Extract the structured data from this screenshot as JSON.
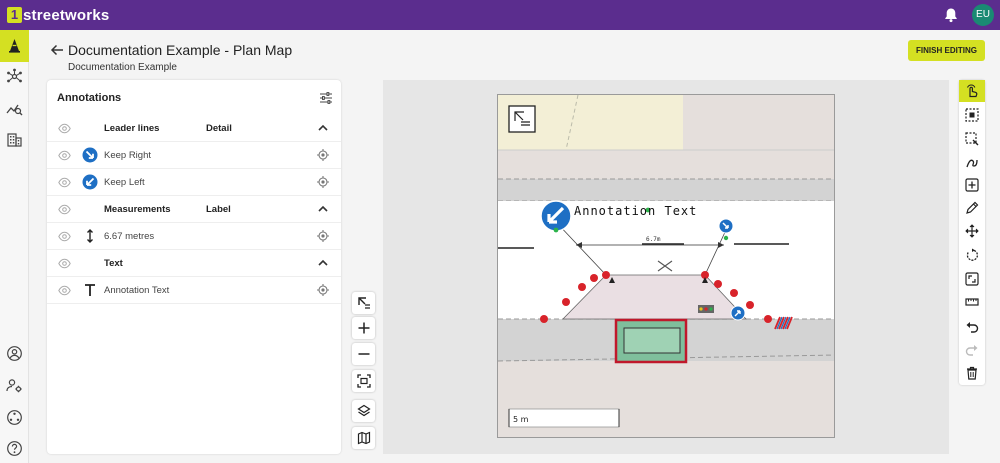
{
  "app": {
    "logo_mark": "1",
    "logo_text": "streetworks",
    "user_initials": "EU"
  },
  "header": {
    "title": "Documentation Example - Plan Map",
    "subtitle": "Documentation Example",
    "finish_label": "FINISH EDITING"
  },
  "panel": {
    "title": "Annotations",
    "leader_group": {
      "label": "Leader lines",
      "column": "Detail"
    },
    "leader_items": [
      "Keep Right",
      "Keep Left"
    ],
    "measure_group": {
      "label": "Measurements",
      "column": "Label"
    },
    "measure_items": [
      "6.67 metres"
    ],
    "text_group": {
      "label": "Text"
    },
    "text_items": [
      "Annotation Text"
    ]
  },
  "plan": {
    "annotation_text": "Annotation Text",
    "measurement_label": "6.7m",
    "scale_label": "5 m"
  },
  "colors": {
    "brand_purple": "#5b2d8e",
    "accent_lime": "#d4e022",
    "avatar_teal": "#1a8a73",
    "sign_blue": "#1e6fc4",
    "cone_red": "#d8232a"
  },
  "icons": [
    "bell-icon",
    "arrow-left-icon",
    "eye-icon",
    "keep-right-sign-icon",
    "keep-left-sign-icon",
    "vertical-arrow-icon",
    "text-t-icon",
    "target-icon",
    "chevron-up-icon",
    "filter-sliders-icon",
    "zoom-in-icon",
    "zoom-out-icon",
    "layers-icon",
    "map-icon"
  ]
}
